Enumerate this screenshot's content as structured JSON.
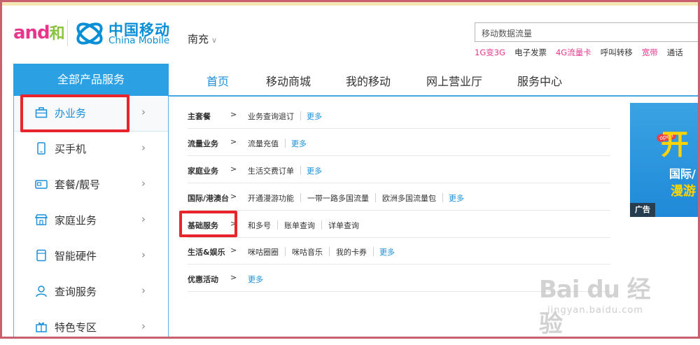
{
  "header": {
    "and_logo": "and",
    "and_he": "和",
    "cm_name_cn": "中国移动",
    "cm_name_en": "China Mobile",
    "city": "南充",
    "search_value": "移动数据流量",
    "hot_links": [
      {
        "label": "1G变3G",
        "color": "#e9358b"
      },
      {
        "label": "电子发票",
        "color": "#333333"
      },
      {
        "label": "4G流量卡",
        "color": "#e9358b"
      },
      {
        "label": "呼叫转移",
        "color": "#333333"
      },
      {
        "label": "宽带",
        "color": "#e9358b"
      },
      {
        "label": "通话",
        "color": "#333333"
      }
    ]
  },
  "nav": {
    "all_products": "全部产品服务",
    "items": [
      "首页",
      "移动商城",
      "我的移动",
      "网上营业厅",
      "服务中心"
    ]
  },
  "sidebar": {
    "items": [
      {
        "label": "办业务",
        "icon": "briefcase-icon"
      },
      {
        "label": "买手机",
        "icon": "phone-icon"
      },
      {
        "label": "套餐/靓号",
        "icon": "card-icon"
      },
      {
        "label": "家庭业务",
        "icon": "shop-icon"
      },
      {
        "label": "智能硬件",
        "icon": "device-icon"
      },
      {
        "label": "查询服务",
        "icon": "user-icon"
      },
      {
        "label": "特色专区",
        "icon": "gift-icon"
      }
    ]
  },
  "rows": [
    {
      "title": "主套餐",
      "links": [
        "业务查询退订"
      ],
      "more": "更多"
    },
    {
      "title": "流量业务",
      "links": [
        "流量充值"
      ],
      "more": "更多"
    },
    {
      "title": "家庭业务",
      "links": [
        "生活交费订单"
      ],
      "more": "更多"
    },
    {
      "title": "国际/港澳台",
      "links": [
        "开通漫游功能",
        "一带一路多国流量",
        "欧洲多国流量包"
      ],
      "more": "更多"
    },
    {
      "title": "基础服务",
      "links": [
        "和多号",
        "账单查询",
        "详单查询"
      ],
      "more": ""
    },
    {
      "title": "生活&娱乐",
      "links": [
        "咪咕圈圈",
        "咪咕音乐",
        "我的卡券"
      ],
      "more": "更多"
    },
    {
      "title": "优惠活动",
      "links": [],
      "more": "更多"
    }
  ],
  "gt": ">",
  "arrow": "›",
  "ad": {
    "tag": "广告",
    "open": "open",
    "big": "开",
    "line1": "国际/",
    "line2": "漫游"
  },
  "watermark": {
    "text": "Bai du 经验",
    "url": "jingyan.baidu.com"
  }
}
